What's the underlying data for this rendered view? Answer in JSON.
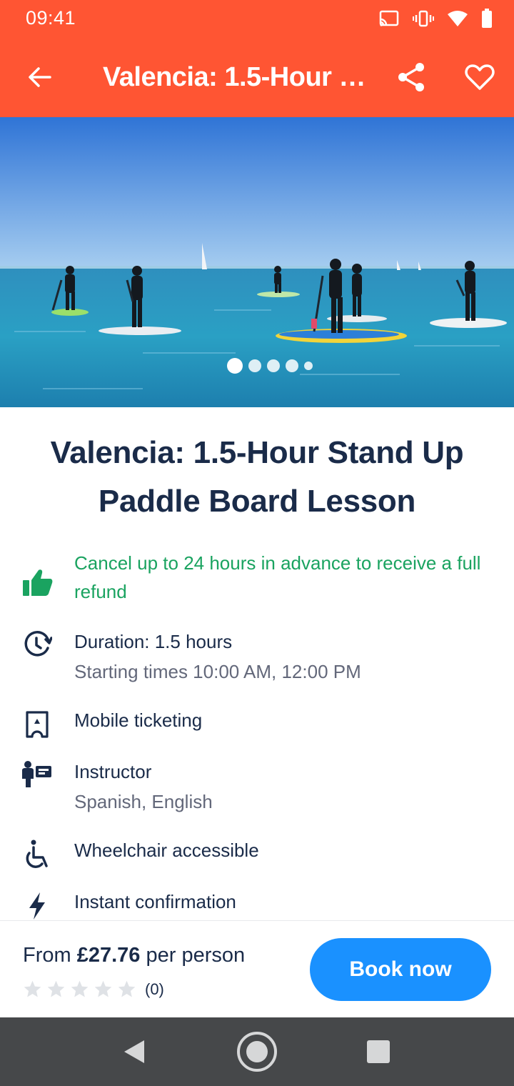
{
  "status": {
    "time": "09:41"
  },
  "toolbar": {
    "title": "Valencia: 1.5-Hour Stand Up Paddle Board Lesson"
  },
  "hero": {
    "slide_count": 5,
    "active_slide": 1
  },
  "activity": {
    "title": "Valencia: 1.5-Hour Stand Up Paddle Board Lesson",
    "features": {
      "cancel": "Cancel up to 24 hours in advance to receive a full refund",
      "duration": "Duration: 1.5 hours",
      "starting_times": "Starting times 10:00 AM, 12:00 PM",
      "ticketing": "Mobile ticketing",
      "instructor": "Instructor",
      "languages": "Spanish, English",
      "accessibility": "Wheelchair accessible",
      "confirmation": "Instant confirmation"
    }
  },
  "booking": {
    "price_prefix": "From",
    "price": "£27.76",
    "price_suffix": "per person",
    "rating_count": "(0)",
    "book_label": "Book now"
  },
  "colors": {
    "brand": "#ff5533",
    "cta": "#1a91ff",
    "success": "#1aa360",
    "text_primary": "#1a2b49",
    "text_secondary": "#63687a"
  }
}
